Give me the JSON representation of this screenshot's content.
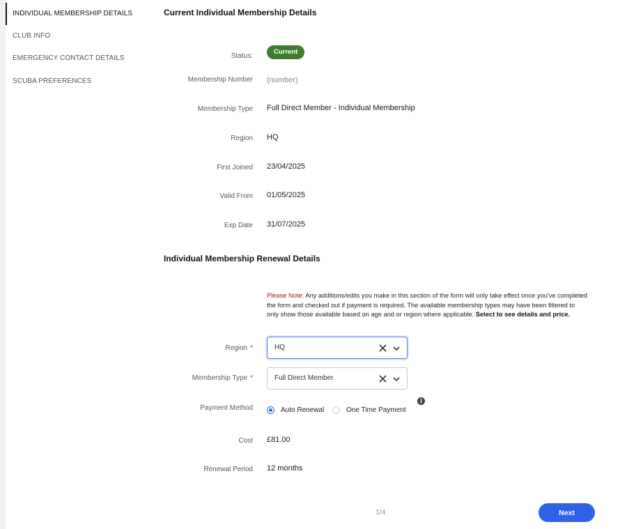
{
  "sidebar": {
    "items": [
      {
        "label": "INDIVIDUAL MEMBERSHIP DETAILS"
      },
      {
        "label": "CLUB INFO"
      },
      {
        "label": "EMERGENCY CONTACT DETAILS"
      },
      {
        "label": "SCUBA PREFERENCES"
      }
    ]
  },
  "current": {
    "title": "Current Individual Membership Details",
    "status_label": "Status:",
    "status_value": "Current",
    "status_color": "#3e7d31",
    "membership_number_label": "Membership Number",
    "membership_number_value": "(number)",
    "membership_type_label": "Membership Type",
    "membership_type_value": "Full Direct Member - Individual Membership",
    "region_label": "Region",
    "region_value": "HQ",
    "first_joined_label": "First Joined",
    "first_joined_value": "23/04/2025",
    "valid_from_label": "Valid From",
    "valid_from_value": "01/05/2025",
    "exp_date_label": "Exp Date",
    "exp_date_value": "31/07/2025"
  },
  "renewal": {
    "title": "Individual Membership Renewal Details",
    "note_prefix": "Please Note:",
    "note_body": " Any additions/edits you make in this section of the form will only take effect once you've completed the form and checked out if payment is required. The available membership types may have been filtered to only show those available based on age and or region where applicable. ",
    "note_bold": "Select to see details and price.",
    "region_label": "Region",
    "region_value": "HQ",
    "membership_type_label": "Membership Type",
    "membership_type_value": "Full Direct Member",
    "required_mark": "*",
    "payment_method_label": "Payment Method",
    "payment_options": [
      "Auto Renewal",
      "One Time Payment"
    ],
    "payment_selected": "Auto Renewal",
    "info_icon": "info-icon",
    "cost_label": "Cost",
    "cost_value": "£81.00",
    "renewal_period_label": "Renewal Period",
    "renewal_period_value": "12 months"
  },
  "footer": {
    "page_indicator": "1/4",
    "next_label": "Next",
    "accent_color": "#2f62e8"
  }
}
